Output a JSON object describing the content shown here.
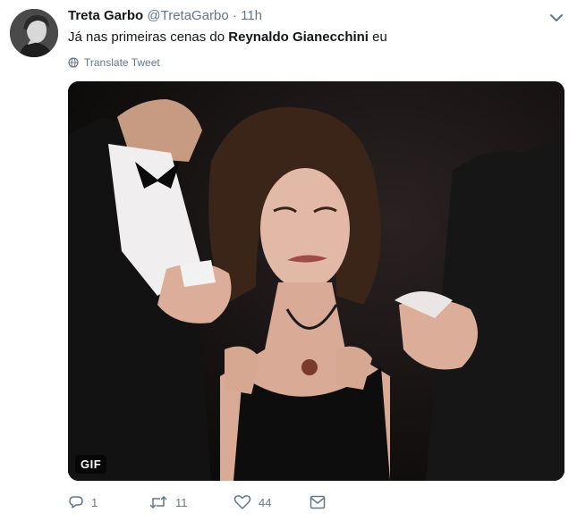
{
  "tweet": {
    "author_name": "Treta Garbo",
    "handle": "@TretaGarbo",
    "separator": "·",
    "time": "11h",
    "text_pre": "Já nas primeiras cenas do ",
    "text_bold": "Reynaldo Gianecchini",
    "text_post": " eu",
    "translate_label": "Translate Tweet",
    "media": {
      "badge": "GIF"
    },
    "actions": {
      "replies": "1",
      "retweets": "11",
      "likes": "44"
    }
  },
  "colors": {
    "text": "#14171a",
    "secondary": "#657786",
    "background": "#ffffff"
  },
  "icons": [
    "caret-down-icon",
    "globe-icon",
    "reply-icon",
    "retweet-icon",
    "like-icon",
    "message-icon"
  ]
}
